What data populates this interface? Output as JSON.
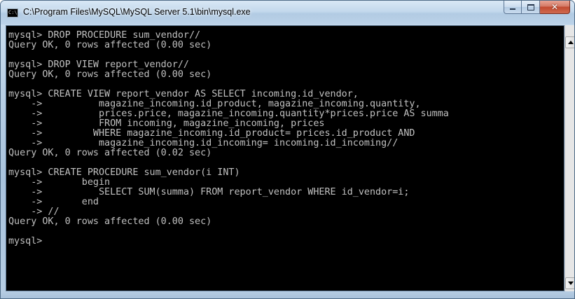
{
  "window": {
    "title": "C:\\Program Files\\MySQL\\MySQL Server 5.1\\bin\\mysql.exe",
    "app_icon_text": "C:\\"
  },
  "caption_buttons": {
    "minimize": "minimize-icon",
    "maximize": "maximize-icon",
    "close": "close-icon",
    "close_glyph": "✕"
  },
  "colors": {
    "console_background": "#000000",
    "console_text": "#c0c0c0",
    "close_button": "#c24a30"
  },
  "console": {
    "lines": [
      "mysql> DROP PROCEDURE sum_vendor//",
      "Query OK, 0 rows affected (0.00 sec)",
      "",
      "mysql> DROP VIEW report_vendor//",
      "Query OK, 0 rows affected (0.00 sec)",
      "",
      "mysql> CREATE VIEW report_vendor AS SELECT incoming.id_vendor,",
      "    ->          magazine_incoming.id_product, magazine_incoming.quantity,",
      "    ->          prices.price, magazine_incoming.quantity*prices.price AS summa",
      "    ->          FROM incoming, magazine_incoming, prices",
      "    ->         WHERE magazine_incoming.id_product= prices.id_product AND",
      "    ->          magazine_incoming.id_incoming= incoming.id_incoming//",
      "Query OK, 0 rows affected (0.02 sec)",
      "",
      "mysql> CREATE PROCEDURE sum_vendor(i INT)",
      "    ->       begin",
      "    ->          SELECT SUM(summa) FROM report_vendor WHERE id_vendor=i;",
      "    ->       end",
      "    -> //",
      "Query OK, 0 rows affected (0.00 sec)",
      "",
      "mysql> "
    ]
  },
  "scrollbar": {
    "up_arrow": "scroll-up-arrow-icon",
    "down_arrow": "scroll-down-arrow-icon"
  }
}
